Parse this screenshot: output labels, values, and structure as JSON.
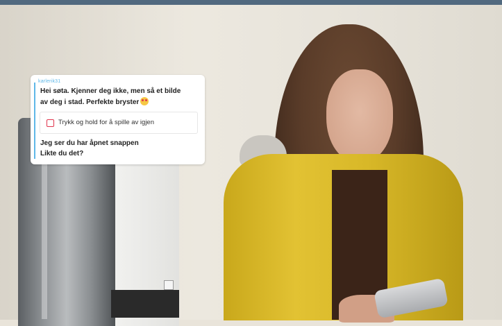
{
  "chat": {
    "username": "karlerik31",
    "message_line1": "Hei søta. Kjenner deg ikke, men så et bilde",
    "message_line2": "av deg i stad. Perfekte bryster",
    "emoji": "smiling-face-with-heart-eyes",
    "replay_label": "Trykk og hold for å spille av igjen",
    "message2_line1": "Jeg ser du har åpnet snappen",
    "message2_line2": "Likte du det?"
  },
  "colors": {
    "accent_blue": "#5fb8e8",
    "snap_red": "#e0334c",
    "top_bar": "#51697f"
  }
}
